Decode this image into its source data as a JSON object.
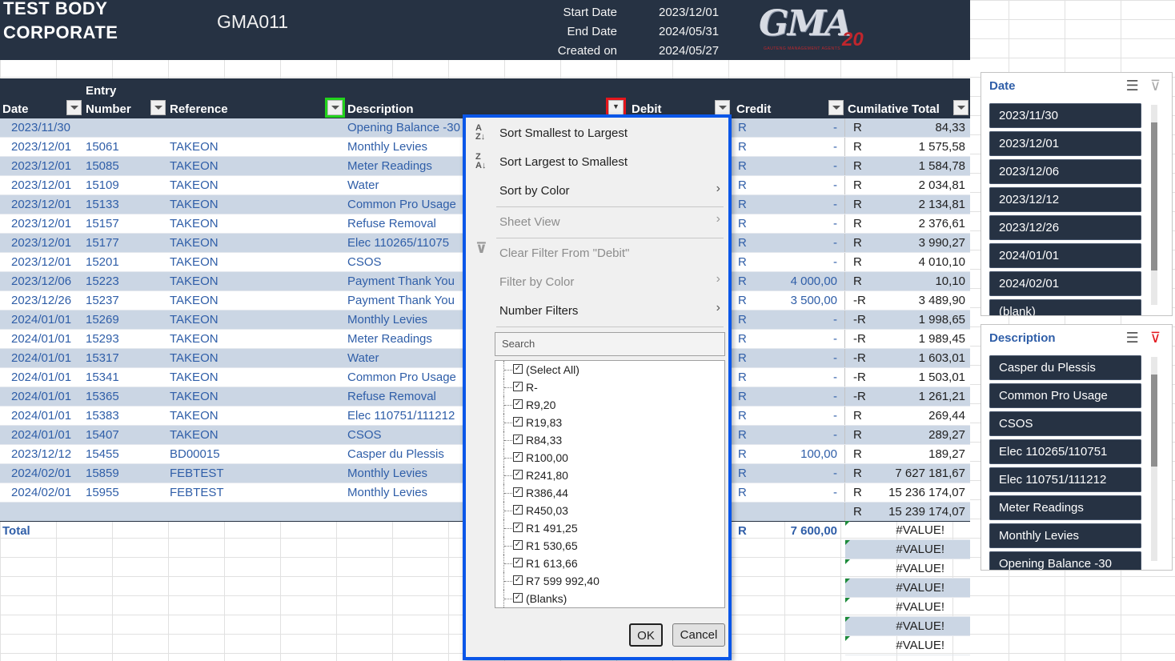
{
  "banner": {
    "company": "TEST BODY CORPORATE",
    "code": "GMA011",
    "start_label": "Start Date",
    "start_value": "2023/12/01",
    "end_label": "End Date",
    "end_value": "2024/05/31",
    "created_label": "Created on",
    "created_value": "2024/05/27",
    "logo_text": "GMA",
    "logo_number": "20",
    "logo_tagline": "GAUTENG MANAGEMENT AGENTS"
  },
  "table": {
    "headers": {
      "date": "Date",
      "entry_line1": "Entry",
      "entry_line2": "Number",
      "reference": "Reference",
      "description": "Description",
      "debit": "Debit",
      "credit": "Credit",
      "cumulative": "Cumilative Total"
    },
    "rows": [
      {
        "date": "2023/11/30",
        "entry": "",
        "ref": "",
        "desc": "Opening Balance -30",
        "cr": "R",
        "cval": "-",
        "tr": "R",
        "total": "84,33"
      },
      {
        "date": "2023/12/01",
        "entry": "15061",
        "ref": "TAKEON",
        "desc": "Monthly Levies",
        "cr": "R",
        "cval": "-",
        "tr": "R",
        "total": "1 575,58"
      },
      {
        "date": "2023/12/01",
        "entry": "15085",
        "ref": "TAKEON",
        "desc": "Meter Readings",
        "cr": "R",
        "cval": "-",
        "tr": "R",
        "total": "1 584,78"
      },
      {
        "date": "2023/12/01",
        "entry": "15109",
        "ref": "TAKEON",
        "desc": "Water",
        "cr": "R",
        "cval": "-",
        "tr": "R",
        "total": "2 034,81"
      },
      {
        "date": "2023/12/01",
        "entry": "15133",
        "ref": "TAKEON",
        "desc": "Common Pro Usage",
        "cr": "R",
        "cval": "-",
        "tr": "R",
        "total": "2 134,81"
      },
      {
        "date": "2023/12/01",
        "entry": "15157",
        "ref": "TAKEON",
        "desc": "Refuse Removal",
        "cr": "R",
        "cval": "-",
        "tr": "R",
        "total": "2 376,61"
      },
      {
        "date": "2023/12/01",
        "entry": "15177",
        "ref": "TAKEON",
        "desc": "Elec 110265/11075",
        "cr": "R",
        "cval": "-",
        "tr": "R",
        "total": "3 990,27"
      },
      {
        "date": "2023/12/01",
        "entry": "15201",
        "ref": "TAKEON",
        "desc": "CSOS",
        "cr": "R",
        "cval": "-",
        "tr": "R",
        "total": "4 010,10"
      },
      {
        "date": "2023/12/06",
        "entry": "15223",
        "ref": "TAKEON",
        "desc": "Payment Thank You",
        "cr": "R",
        "cval": "4 000,00",
        "tr": "R",
        "total": "10,10"
      },
      {
        "date": "2023/12/26",
        "entry": "15237",
        "ref": "TAKEON",
        "desc": "Payment Thank You",
        "cr": "R",
        "cval": "3 500,00",
        "tr": "-R",
        "total": "3 489,90"
      },
      {
        "date": "2024/01/01",
        "entry": "15269",
        "ref": "TAKEON",
        "desc": "Monthly Levies",
        "cr": "R",
        "cval": "-",
        "tr": "-R",
        "total": "1 998,65"
      },
      {
        "date": "2024/01/01",
        "entry": "15293",
        "ref": "TAKEON",
        "desc": "Meter Readings",
        "cr": "R",
        "cval": "-",
        "tr": "-R",
        "total": "1 989,45"
      },
      {
        "date": "2024/01/01",
        "entry": "15317",
        "ref": "TAKEON",
        "desc": "Water",
        "cr": "R",
        "cval": "-",
        "tr": "-R",
        "total": "1 603,01"
      },
      {
        "date": "2024/01/01",
        "entry": "15341",
        "ref": "TAKEON",
        "desc": "Common Pro Usage",
        "cr": "R",
        "cval": "-",
        "tr": "-R",
        "total": "1 503,01"
      },
      {
        "date": "2024/01/01",
        "entry": "15365",
        "ref": "TAKEON",
        "desc": "Refuse Removal",
        "cr": "R",
        "cval": "-",
        "tr": "-R",
        "total": "1 261,21"
      },
      {
        "date": "2024/01/01",
        "entry": "15383",
        "ref": "TAKEON",
        "desc": "Elec 110751/111212",
        "cr": "R",
        "cval": "-",
        "tr": "R",
        "total": "269,44"
      },
      {
        "date": "2024/01/01",
        "entry": "15407",
        "ref": "TAKEON",
        "desc": "CSOS",
        "cr": "R",
        "cval": "-",
        "tr": "R",
        "total": "289,27"
      },
      {
        "date": "2023/12/12",
        "entry": "15455",
        "ref": "BD00015",
        "desc": "Casper du Plessis",
        "cr": "R",
        "cval": "100,00",
        "tr": "R",
        "total": "189,27"
      },
      {
        "date": "2024/02/01",
        "entry": "15859",
        "ref": "FEBTEST",
        "desc": "Monthly Levies",
        "cr": "R",
        "cval": "-",
        "tr": "R",
        "total": "7 627 181,67"
      },
      {
        "date": "2024/02/01",
        "entry": "15955",
        "ref": "FEBTEST",
        "desc": "Monthly Levies",
        "cr": "R",
        "cval": "-",
        "tr": "R",
        "total": "15 236 174,07"
      },
      {
        "date": "",
        "entry": "",
        "ref": "",
        "desc": "",
        "cr": "",
        "cval": "",
        "tr": "R",
        "total": "15 239 174,07"
      }
    ],
    "total_label": "Total",
    "total_cr": "R",
    "total_credit": "7 600,00",
    "value_errors": [
      "#VALUE!",
      "#VALUE!",
      "#VALUE!",
      "#VALUE!",
      "#VALUE!",
      "#VALUE!",
      "#VALUE!"
    ]
  },
  "filter_menu": {
    "sort_asc": "Sort Smallest to Largest",
    "sort_desc": "Sort Largest to Smallest",
    "sort_color": "Sort by Color",
    "sheet_view": "Sheet View",
    "clear_filter": "Clear Filter From \"Debit\"",
    "filter_color": "Filter by Color",
    "number_filters": "Number Filters",
    "search_placeholder": "Search",
    "options": [
      "(Select All)",
      "R-",
      "R9,20",
      "R19,83",
      "R84,33",
      "R100,00",
      "R241,80",
      "R386,44",
      "R450,03",
      "R1 491,25",
      "R1 530,65",
      "R1 613,66",
      "R7 599 992,40",
      "(Blanks)"
    ],
    "ok_label": "OK",
    "cancel_label": "Cancel"
  },
  "slicer_date": {
    "title": "Date",
    "items": [
      "2023/11/30",
      "2023/12/01",
      "2023/12/06",
      "2023/12/12",
      "2023/12/26",
      "2024/01/01",
      "2024/02/01",
      "(blank)"
    ]
  },
  "slicer_description": {
    "title": "Description",
    "items": [
      "Casper du Plessis",
      "Common Pro Usage",
      "CSOS",
      "Elec 110265/110751",
      "Elec 110751/111212",
      "Meter Readings",
      "Monthly Levies",
      "Opening Balance -30"
    ]
  },
  "colors": {
    "header_bg": "#263243",
    "band": "#cbd6e4",
    "link_text": "#2f5ea8",
    "highlight_green": "#22d31c",
    "highlight_red": "#e3161c",
    "dropdown_border": "#0a56e8"
  }
}
